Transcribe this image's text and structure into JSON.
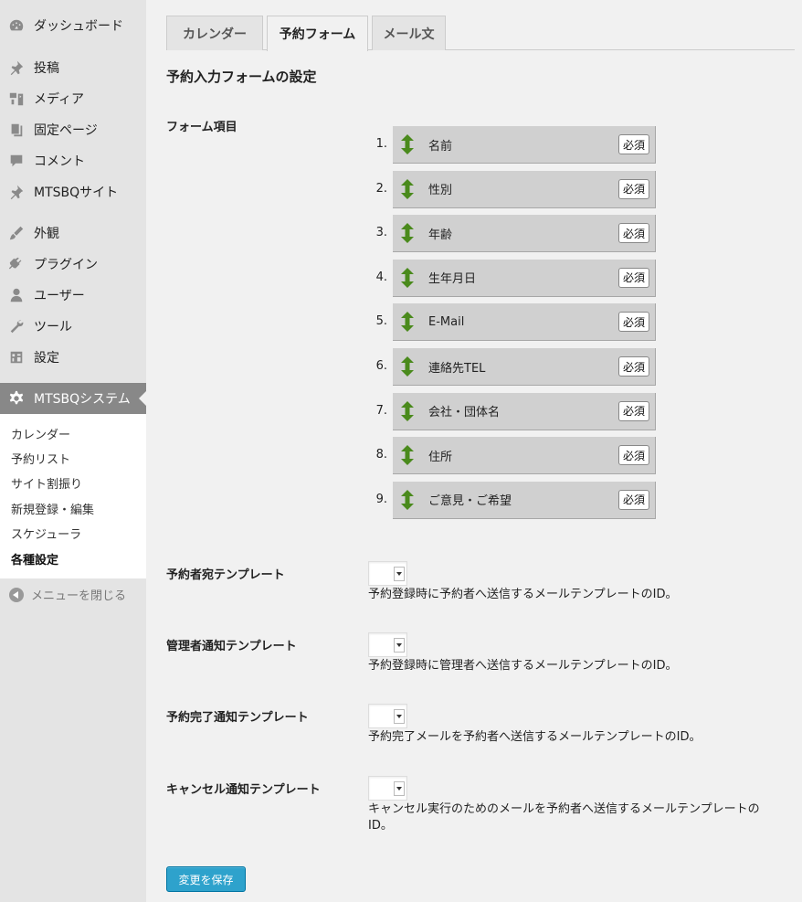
{
  "sidebar": {
    "items": [
      {
        "label": "ダッシュボード",
        "icon": "dashboard-icon"
      },
      {
        "label": "投稿",
        "icon": "pin-icon"
      },
      {
        "label": "メディア",
        "icon": "media-icon"
      },
      {
        "label": "固定ページ",
        "icon": "page-icon"
      },
      {
        "label": "コメント",
        "icon": "comment-icon"
      },
      {
        "label": "MTSBQサイト",
        "icon": "pin-icon"
      },
      {
        "label": "外観",
        "icon": "brush-icon"
      },
      {
        "label": "プラグイン",
        "icon": "plugin-icon"
      },
      {
        "label": "ユーザー",
        "icon": "user-icon"
      },
      {
        "label": "ツール",
        "icon": "wrench-icon"
      },
      {
        "label": "設定",
        "icon": "settings-icon"
      },
      {
        "label": "MTSBQシステム",
        "icon": "gear-icon"
      }
    ],
    "submenu": [
      "カレンダー",
      "予約リスト",
      "サイト割振り",
      "新規登録・編集",
      "スケジューラ",
      "各種設定"
    ],
    "collapse_label": "メニューを閉じる"
  },
  "tabs": [
    "カレンダー",
    "予約フォーム",
    "メール文"
  ],
  "section_title": "予約入力フォームの設定",
  "form_items_label": "フォーム項目",
  "form_items": [
    {
      "num": "1.",
      "name": "名前",
      "required": "必須"
    },
    {
      "num": "2.",
      "name": "性別",
      "required": "必須"
    },
    {
      "num": "3.",
      "name": "年齢",
      "required": "必須"
    },
    {
      "num": "4.",
      "name": "生年月日",
      "required": "必須"
    },
    {
      "num": "5.",
      "name": "E-Mail",
      "required": "必須"
    },
    {
      "num": "6.",
      "name": "連絡先TEL",
      "required": "必須"
    },
    {
      "num": "7.",
      "name": "会社・団体名",
      "required": "必須"
    },
    {
      "num": "8.",
      "name": "住所",
      "required": "必須"
    },
    {
      "num": "9.",
      "name": "ご意見・ご希望",
      "required": "必須"
    }
  ],
  "templates": [
    {
      "label": "予約者宛テンプレート",
      "desc": "予約登録時に予約者へ送信するメールテンプレートのID。"
    },
    {
      "label": "管理者通知テンプレート",
      "desc": "予約登録時に管理者へ送信するメールテンプレートのID。"
    },
    {
      "label": "予約完了通知テンプレート",
      "desc": "予約完了メールを予約者へ送信するメールテンプレートのID。"
    },
    {
      "label": "キャンセル通知テンプレート",
      "desc": "キャンセル実行のためのメールを予約者へ送信するメールテンプレートのID。"
    }
  ],
  "save_label": "変更を保存",
  "colors": {
    "primary_button": "#2ea2cc",
    "sort_arrow": "#4a8a1c",
    "sidebar_active": "#888888"
  }
}
